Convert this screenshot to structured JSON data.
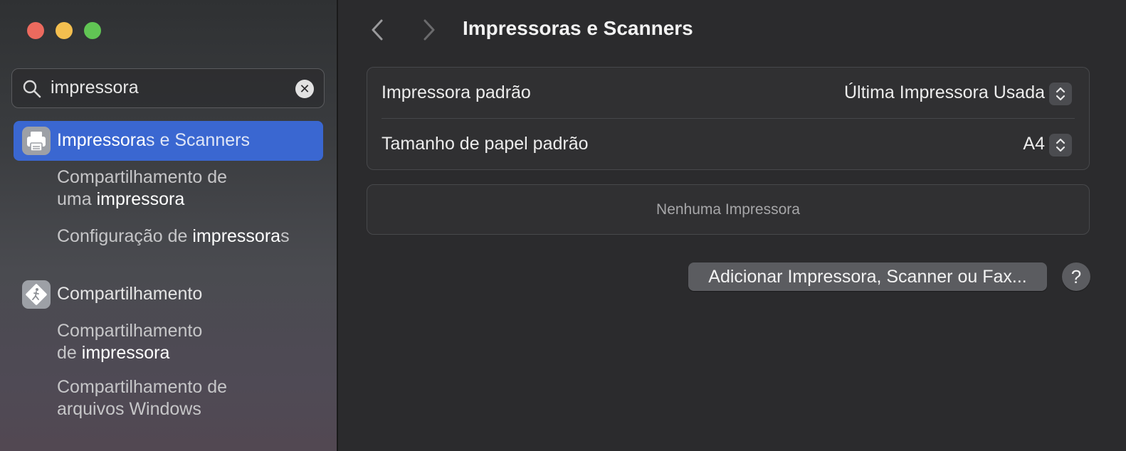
{
  "window": {
    "title": "Impressoras e Scanners",
    "controls": {
      "close": "close",
      "minimize": "minimize",
      "zoom": "zoom"
    }
  },
  "colors": {
    "selection": "#3a67d1",
    "close": "#ec6a5e",
    "minimize": "#f4bf4f",
    "zoom": "#61c554"
  },
  "search": {
    "value": "impressora",
    "icon": "magnifying-glass-icon",
    "clear_icon": "clear-x-icon",
    "clear_glyph": "✕"
  },
  "sidebar": {
    "results": [
      {
        "label_pre": "Impressora",
        "label_post": "s e Scanners",
        "icon": "printer-icon",
        "selected": true,
        "subitems": [
          {
            "line1_pre": "Compartilhamento de",
            "line2_pre": "uma ",
            "line2_match": "impressora"
          },
          {
            "line1_pre": "Configuração de ",
            "line1_match": "impressora",
            "line1_post": "s"
          }
        ]
      },
      {
        "label": "Compartilhamento",
        "icon": "sharing-icon",
        "selected": false,
        "subitems": [
          {
            "line1_pre": "Compartilhamento",
            "line2_pre": "de ",
            "line2_match": "impressora"
          },
          {
            "line1_pre": "Compartilhamento de",
            "line2_pre": "arquivos Windows"
          }
        ]
      }
    ]
  },
  "main": {
    "title": "Impressoras e Scanners",
    "settings": [
      {
        "label": "Impressora padrão",
        "value": "Última Impressora Usada"
      },
      {
        "label": "Tamanho de papel padrão",
        "value": "A4"
      }
    ],
    "printer_list_empty": "Nenhuma Impressora",
    "add_button": "Adicionar Impressora, Scanner ou Fax...",
    "help_glyph": "?"
  }
}
